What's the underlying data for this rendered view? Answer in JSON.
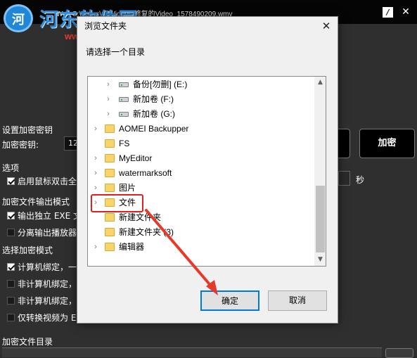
{
  "app": {
    "title": "Wait        C:\\Users\\pc\\Videos\\修复的Video_1578490209.wmv",
    "watermark_text": "河东软件园",
    "watermark_url": "www.pc0359.cn",
    "section_key": "设置加密密钥",
    "key_label": "加密密钥:",
    "key_value": "12",
    "encrypt_button": "加密",
    "section_options": "选项",
    "option_dblclick": "启用鼠标双击全",
    "seconds_label": "秒",
    "section_output": "加密文件输出模式",
    "output_exe": "输出独立 EXE 文",
    "output_player": "分离输出播放器",
    "section_mode": "选择加密模式",
    "mode_bind": "计算机绑定，一",
    "mode_nonbind1": "非计算机绑定，",
    "mode_nonbind2": "非计算机绑定，",
    "mode_convert": "仅转换视频为 EX",
    "section_dir": "加密文件目录"
  },
  "dialog": {
    "title": "浏览文件夹",
    "prompt": "请选择一个目录",
    "close_glyph": "✕",
    "ok_label": "确定",
    "cancel_label": "取消",
    "items": [
      {
        "label": "备份[勿删] (E:)",
        "kind": "drive"
      },
      {
        "label": "新加卷 (F:)",
        "kind": "drive"
      },
      {
        "label": "新加卷 (G:)",
        "kind": "drive"
      },
      {
        "label": "AOMEI Backupper",
        "kind": "folder"
      },
      {
        "label": "FS",
        "kind": "folder"
      },
      {
        "label": "MyEditor",
        "kind": "folder"
      },
      {
        "label": "watermarksoft",
        "kind": "folder"
      },
      {
        "label": "图片",
        "kind": "folder"
      },
      {
        "label": "文件",
        "kind": "folder",
        "selected": true
      },
      {
        "label": "新建文件夹",
        "kind": "folder"
      },
      {
        "label": "新建文件夹 (3)",
        "kind": "folder"
      },
      {
        "label": "编辑器",
        "kind": "folder"
      }
    ]
  },
  "colors": {
    "highlight": "#e02020",
    "arrow": "#e53a2a",
    "primary_border": "#0078d7"
  },
  "icons": {
    "chevron": "›",
    "close": "✕",
    "edit": "/"
  }
}
